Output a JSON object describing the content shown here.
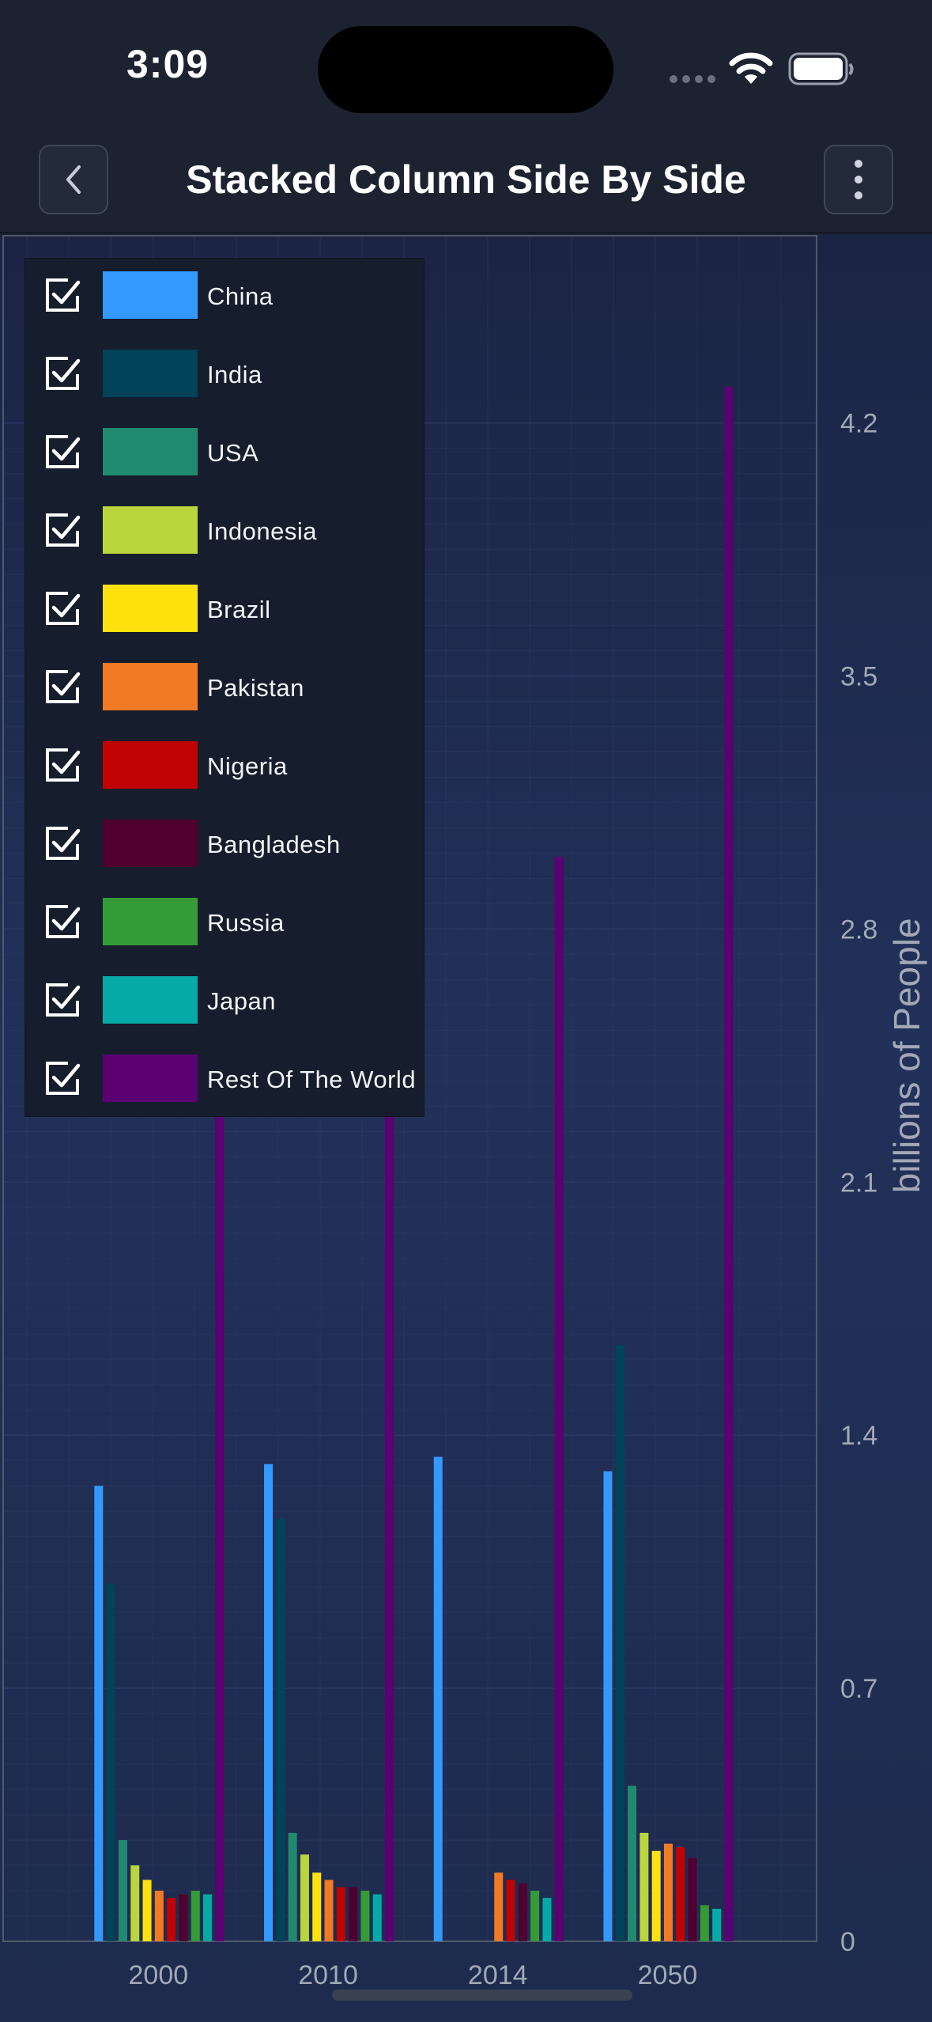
{
  "status": {
    "time": "3:09"
  },
  "header": {
    "title": "Stacked Column Side By Side"
  },
  "icons": {
    "back": "chevron-left-icon",
    "more": "more-vertical-icon",
    "check": "checkbox-checked-icon"
  },
  "colors": {
    "grid": "#2c3a66",
    "axis_text": "#a2a8b6",
    "plot_border": "#50596b"
  },
  "legend": {
    "placement": "top-left",
    "items": [
      {
        "label": "China",
        "color": "#3399ff",
        "checked": true
      },
      {
        "label": "India",
        "color": "#014358",
        "checked": true
      },
      {
        "label": "USA",
        "color": "#208a71",
        "checked": true
      },
      {
        "label": "Indonesia",
        "color": "#bbd53d",
        "checked": true
      },
      {
        "label": "Brazil",
        "color": "#ffe10d",
        "checked": true
      },
      {
        "label": "Pakistan",
        "color": "#f37a24",
        "checked": true
      },
      {
        "label": "Nigeria",
        "color": "#c10202",
        "checked": true
      },
      {
        "label": "Bangladesh",
        "color": "#50002e",
        "checked": true
      },
      {
        "label": "Russia",
        "color": "#359b37",
        "checked": true
      },
      {
        "label": "Japan",
        "color": "#05aaa8",
        "checked": true
      },
      {
        "label": "Rest Of The World",
        "color": "#5a0072",
        "checked": true
      }
    ]
  },
  "chart_data": {
    "type": "bar",
    "title": "Stacked Column Side By Side",
    "xlabel": "",
    "ylabel": "billions of People",
    "ylim": [
      0,
      4.72
    ],
    "yticks": [
      "0",
      "0.7",
      "1.4",
      "2.1",
      "2.8",
      "3.5",
      "4.2"
    ],
    "ytick_values": [
      0,
      0.7,
      1.4,
      2.1,
      2.8,
      3.5,
      4.2
    ],
    "y_axis_position": "right",
    "grid": true,
    "categories": [
      "2000",
      "2010",
      "2014",
      "2050"
    ],
    "series": [
      {
        "name": "China",
        "values": [
          1.26,
          1.32,
          1.34,
          1.3
        ]
      },
      {
        "name": "India",
        "values": [
          0.99,
          1.17,
          0,
          1.65
        ]
      },
      {
        "name": "USA",
        "values": [
          0.28,
          0.3,
          0,
          0.43
        ]
      },
      {
        "name": "Indonesia",
        "values": [
          0.21,
          0.24,
          0,
          0.3
        ]
      },
      {
        "name": "Brazil",
        "values": [
          0.17,
          0.19,
          0,
          0.25
        ]
      },
      {
        "name": "Pakistan",
        "values": [
          0.14,
          0.17,
          0.19,
          0.27
        ]
      },
      {
        "name": "Nigeria",
        "values": [
          0.12,
          0.15,
          0.17,
          0.26
        ]
      },
      {
        "name": "Bangladesh",
        "values": [
          0.13,
          0.15,
          0.16,
          0.23
        ]
      },
      {
        "name": "Russia",
        "values": [
          0.14,
          0.14,
          0.14,
          0.1
        ]
      },
      {
        "name": "Japan",
        "values": [
          0.13,
          0.13,
          0.12,
          0.09
        ]
      },
      {
        "name": "Rest Of The World",
        "values": [
          2.34,
          2.34,
          3.0,
          4.3
        ]
      }
    ]
  }
}
